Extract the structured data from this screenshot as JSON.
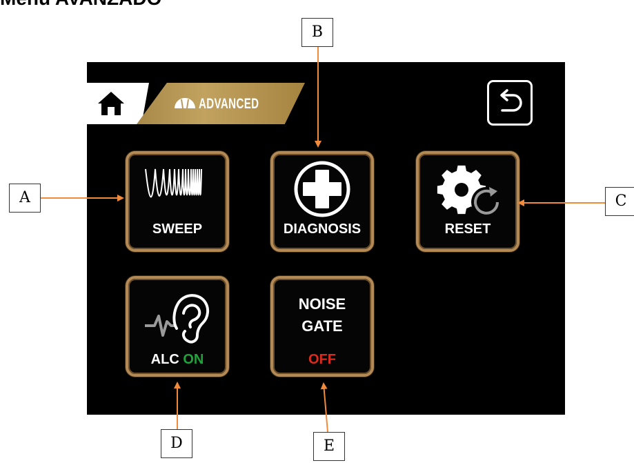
{
  "document": {
    "title": "Menu AVANZADO"
  },
  "header": {
    "home_icon": "home-icon",
    "advanced_icon": "advanced-icon",
    "section_label": "ADVANCED",
    "back_icon": "back-arrow-icon",
    "accent_color": "#b8975a"
  },
  "tiles": {
    "sweep": {
      "label": "SWEEP",
      "icon": "sweep-waveform-icon"
    },
    "diagnosis": {
      "label": "DIAGNOSIS",
      "icon": "medical-cross-icon"
    },
    "reset": {
      "label": "RESET",
      "icon": "gear-reset-icon"
    },
    "alc": {
      "label": "ALC",
      "state": "ON",
      "state_color": "#1fa33a",
      "icon": "ear-waveform-icon"
    },
    "noise_gate": {
      "line1": "NOISE",
      "line2": "GATE",
      "state": "OFF",
      "state_color": "#d92b1e"
    }
  },
  "annotations": {
    "a": "A",
    "b": "B",
    "c": "C",
    "d": "D",
    "e": "E",
    "arrow_color": "#f28a3c"
  }
}
